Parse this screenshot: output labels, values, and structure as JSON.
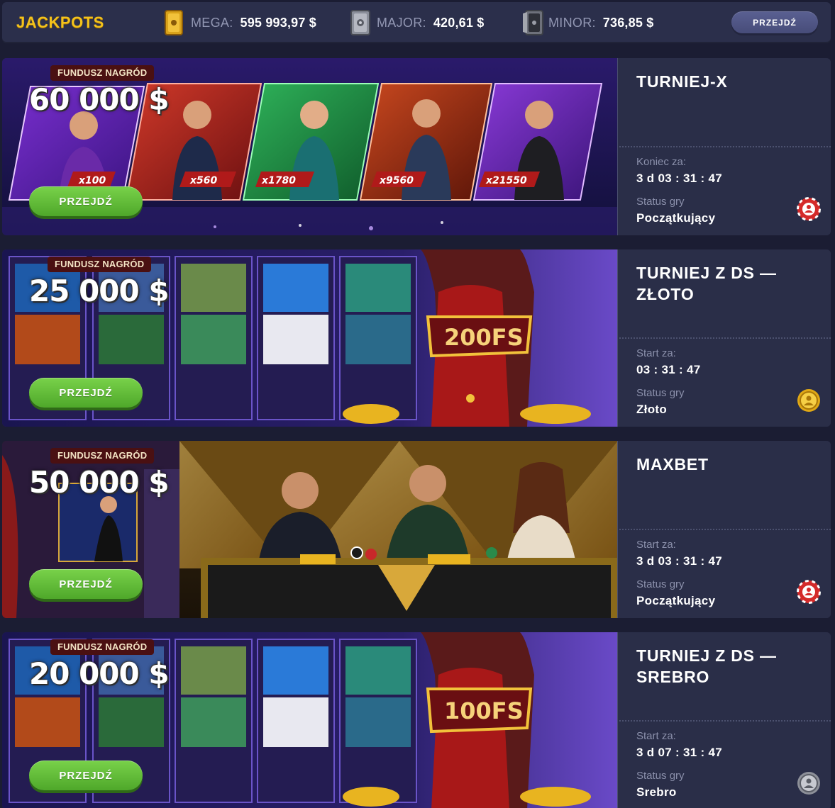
{
  "jackpots": {
    "title": "JACKPOTS",
    "mega": {
      "label": "MEGA:",
      "value": "595 993,97 $"
    },
    "major": {
      "label": "MAJOR:",
      "value": "420,61 $"
    },
    "minor": {
      "label": "MINOR:",
      "value": "736,85 $"
    },
    "go_label": "PRZEJDŹ"
  },
  "tournaments": [
    {
      "fund_label": "FUNDUSZ NAGRÓD",
      "fund_amount": "60 000 $",
      "go_label": "PRZEJDŹ",
      "title": "TURNIEJ-X",
      "time_label": "Koniec za:",
      "time_value": "3 d 03 : 31 : 47",
      "status_label": "Status gry",
      "status_value": "Początkujący",
      "status_icon": "red-chip-icon",
      "multipliers": [
        "x100",
        "x560",
        "x1780",
        "x9560",
        "x21550"
      ]
    },
    {
      "fund_label": "FUNDUSZ NAGRÓD",
      "fund_amount": "25 000 $",
      "go_label": "PRZEJDŹ",
      "title": "TURNIEJ Z DS — ZŁOTO",
      "time_label": "Start za:",
      "time_value": "03 : 31 : 47",
      "status_label": "Status gry",
      "status_value": "Złoto",
      "status_icon": "gold-badge-icon",
      "sign_text": "200FS"
    },
    {
      "fund_label": "FUNDUSZ NAGRÓD",
      "fund_amount": "50 000 $",
      "go_label": "PRZEJDŹ",
      "title": "MAXBET",
      "time_label": "Start za:",
      "time_value": "3 d 03 : 31 : 47",
      "status_label": "Status gry",
      "status_value": "Początkujący",
      "status_icon": "red-chip-icon"
    },
    {
      "fund_label": "FUNDUSZ NAGRÓD",
      "fund_amount": "20 000 $",
      "go_label": "PRZEJDŹ",
      "title": "TURNIEJ Z DS — SREBRO",
      "time_label": "Start za:",
      "time_value": "3 d 07 : 31 : 47",
      "status_label": "Status gry",
      "status_value": "Srebro",
      "status_icon": "silver-badge-icon",
      "sign_text": "100FS"
    }
  ],
  "colors": {
    "background": "#1b1d33",
    "panel": "#2a2e48",
    "accent_gold": "#f3c21c",
    "button_green": "#5cb832",
    "muted_text": "#8b90ab"
  }
}
